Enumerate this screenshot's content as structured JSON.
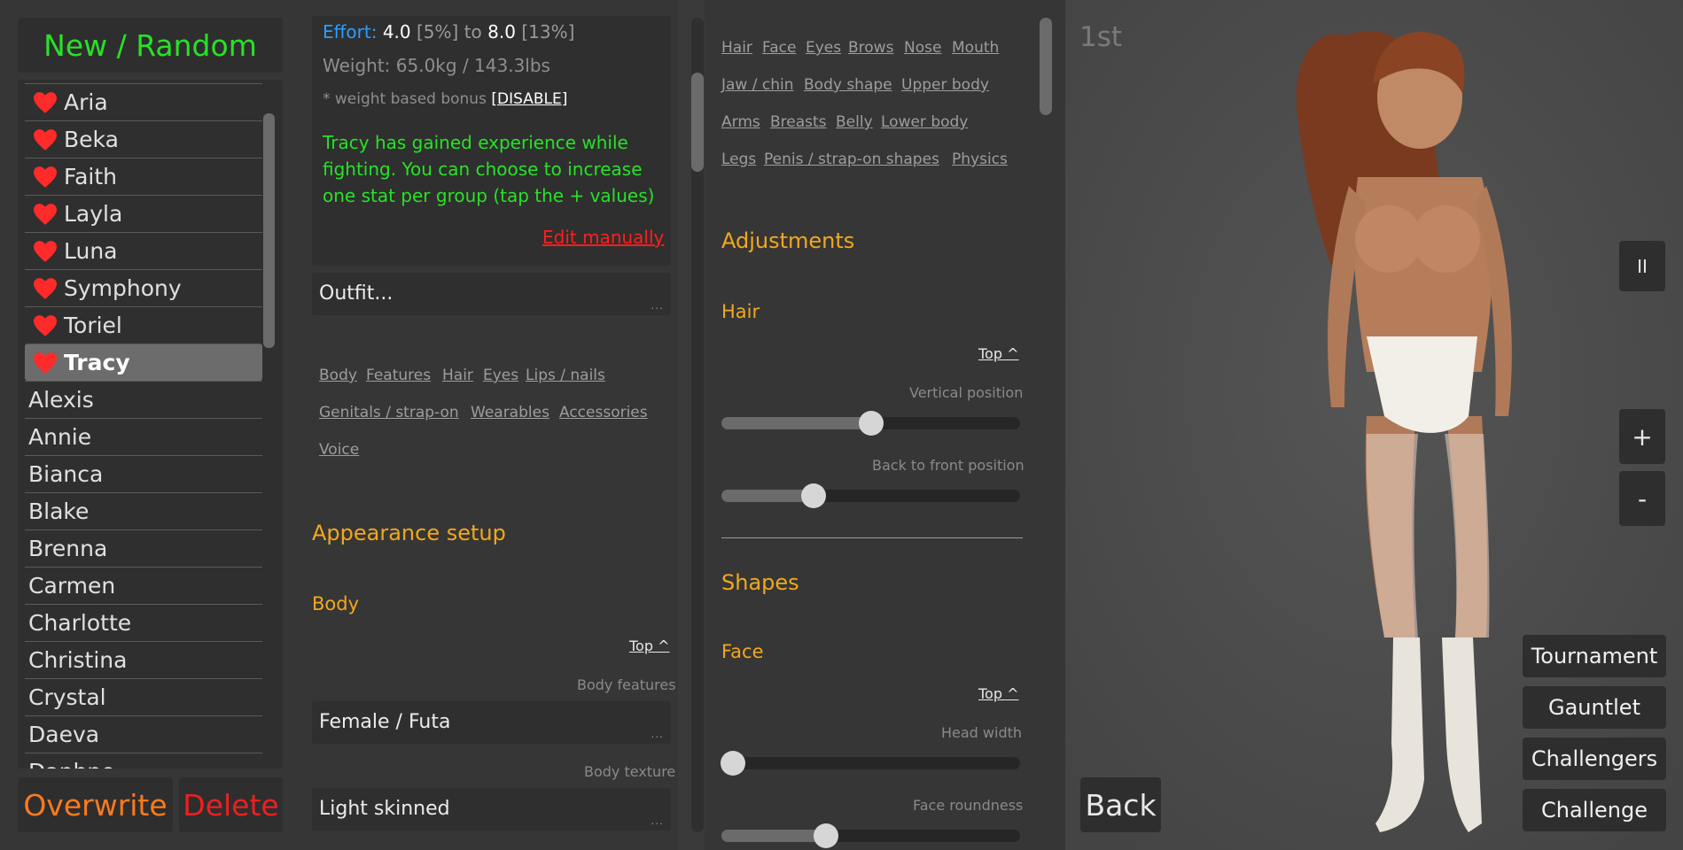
{
  "left": {
    "new_random_label": "New / Random",
    "characters": [
      {
        "name": "Aria",
        "fav": true,
        "selected": false
      },
      {
        "name": "Beka",
        "fav": true,
        "selected": false
      },
      {
        "name": "Faith",
        "fav": true,
        "selected": false
      },
      {
        "name": "Layla",
        "fav": true,
        "selected": false
      },
      {
        "name": "Luna",
        "fav": true,
        "selected": false
      },
      {
        "name": "Symphony",
        "fav": true,
        "selected": false
      },
      {
        "name": "Toriel",
        "fav": true,
        "selected": false
      },
      {
        "name": "Tracy",
        "fav": true,
        "selected": true
      },
      {
        "name": "Alexis",
        "fav": false,
        "selected": false
      },
      {
        "name": "Annie",
        "fav": false,
        "selected": false
      },
      {
        "name": "Bianca",
        "fav": false,
        "selected": false
      },
      {
        "name": "Blake",
        "fav": false,
        "selected": false
      },
      {
        "name": "Brenna",
        "fav": false,
        "selected": false
      },
      {
        "name": "Carmen",
        "fav": false,
        "selected": false
      },
      {
        "name": "Charlotte",
        "fav": false,
        "selected": false
      },
      {
        "name": "Christina",
        "fav": false,
        "selected": false
      },
      {
        "name": "Crystal",
        "fav": false,
        "selected": false
      },
      {
        "name": "Daeva",
        "fav": false,
        "selected": false
      },
      {
        "name": "Daphne",
        "fav": false,
        "selected": false
      }
    ],
    "overwrite_label": "Overwrite",
    "delete_label": "Delete",
    "colors": {
      "green": "#27e227",
      "orange": "#ff7a1c",
      "red": "#ee1f1f",
      "heart": "#ff2a2a"
    }
  },
  "stats": {
    "effort_label": "Effort:",
    "effort_min": "4.0",
    "effort_min_pct": "[5%]",
    "to_word": "to",
    "effort_max": "8.0",
    "effort_max_pct": "[13%]",
    "weight": "Weight: 65.0kg / 143.3lbs",
    "bonus_text": "* weight based bonus",
    "bonus_link": "[DISABLE]",
    "gained_message": "Tracy has gained experience while fighting. You can choose to increase one stat per group (tap the + values)",
    "edit_manually": "Edit manually"
  },
  "outfit": {
    "label": "Outfit..."
  },
  "dots": "...",
  "appearance_nav": {
    "row1": [
      "Body",
      "Features",
      "Hair",
      "Eyes",
      "Lips / nails"
    ],
    "row2": [
      "Genitals / strap-on",
      "Wearables",
      "Accessories"
    ],
    "row3": [
      "Voice"
    ]
  },
  "appearance": {
    "title": "Appearance setup",
    "body_heading": "Body",
    "top_link": "Top ^",
    "body_features_label": "Body features",
    "body_features_value": "Female / Futa",
    "body_texture_label": "Body texture",
    "body_texture_value": "Light skinned"
  },
  "shape_nav": {
    "row1": [
      "Hair",
      "Face",
      "Eyes",
      "Brows",
      "Nose",
      "Mouth"
    ],
    "row2": [
      "Jaw / chin",
      "Body shape",
      "Upper body"
    ],
    "row3": [
      "Arms",
      "Breasts",
      "Belly",
      "Lower body"
    ],
    "row4": [
      "Legs",
      "Penis / strap-on shapes",
      "Physics"
    ]
  },
  "adjustments": {
    "title": "Adjustments",
    "hair_heading": "Hair",
    "top_link": "Top ^",
    "vertical_label": "Vertical position",
    "vertical_value": 0.5,
    "backfront_label": "Back to front position",
    "backfront_value": 0.31
  },
  "shapes": {
    "title": "Shapes",
    "face_heading": "Face",
    "top_link": "Top ^",
    "head_width_label": "Head width",
    "head_width_value": 0.04,
    "face_roundness_label": "Face roundness",
    "face_roundness_value": 0.35
  },
  "viewport": {
    "rank": "1st",
    "pause_icon": "II",
    "zoom_in": "+",
    "zoom_out": "-",
    "back_label": "Back",
    "modes": [
      "Tournament",
      "Gauntlet",
      "Challengers",
      "Challenge"
    ]
  }
}
